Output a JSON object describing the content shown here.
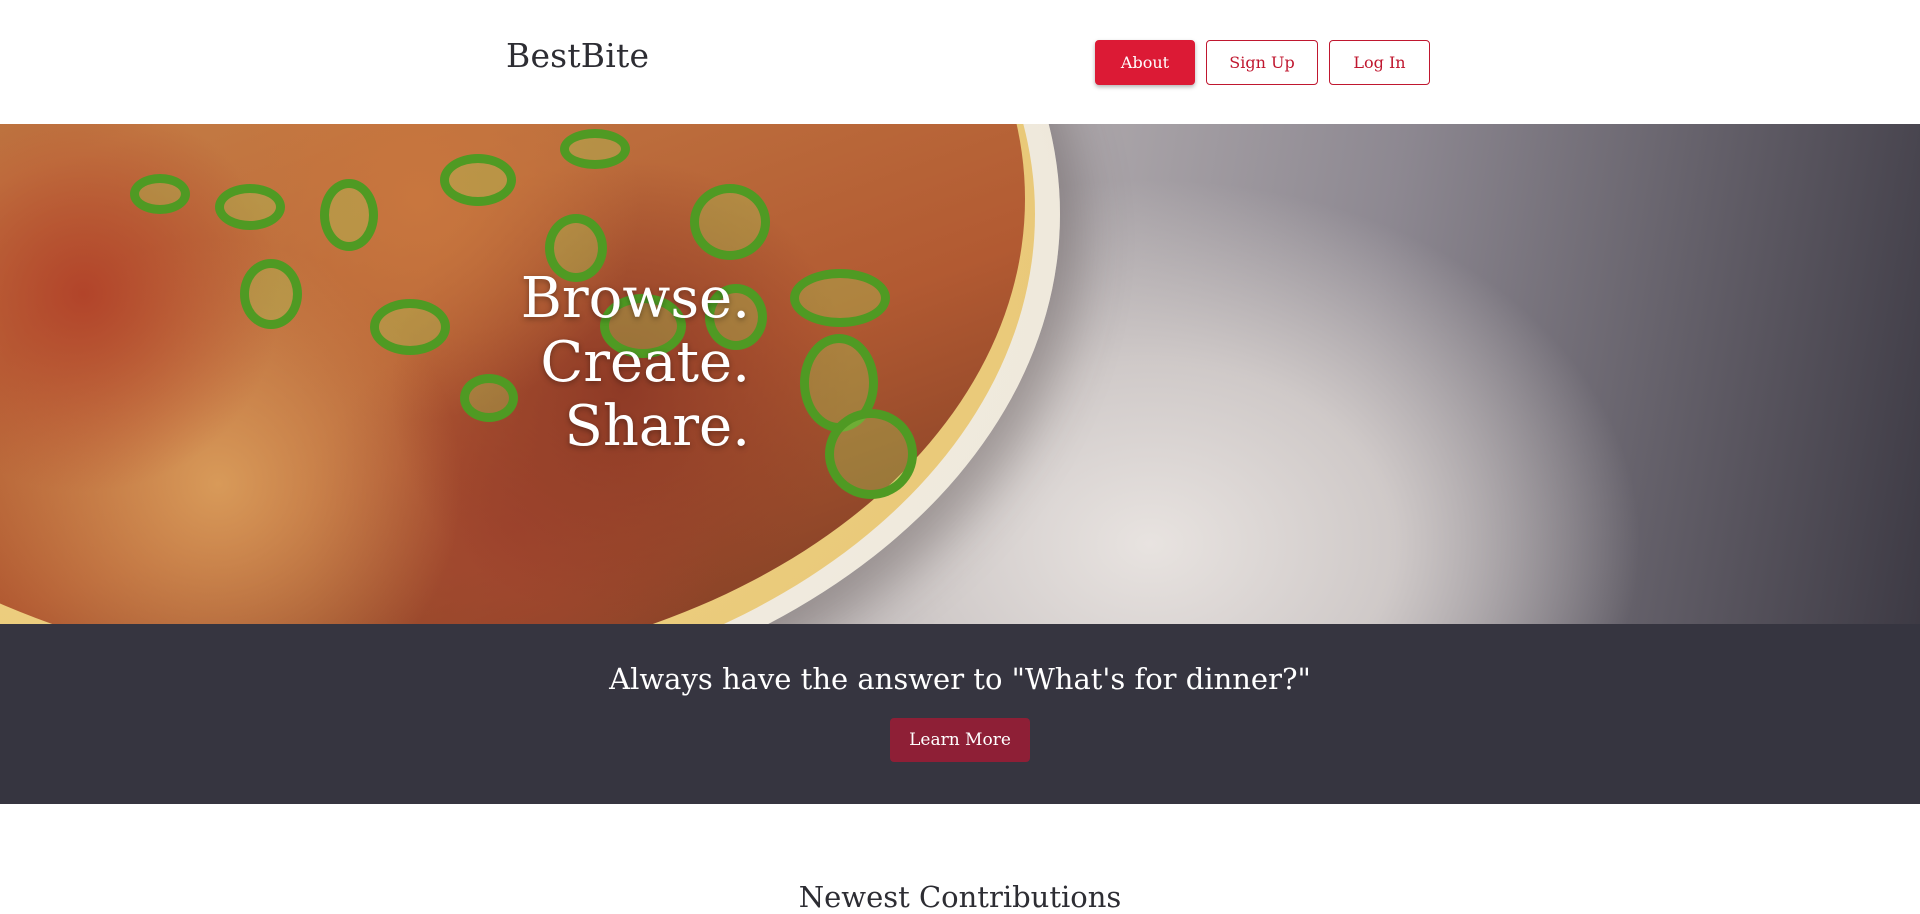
{
  "header": {
    "brand": "BestBite",
    "nav": {
      "about_label": "About",
      "signup_label": "Sign Up",
      "login_label": "Log In"
    }
  },
  "hero": {
    "lines": [
      "Browse.",
      "Create.",
      "Share."
    ]
  },
  "banner": {
    "tagline": "Always have the answer to \"What's for dinner?\"",
    "button_label": "Learn More"
  },
  "section": {
    "title": "Newest Contributions"
  },
  "colors": {
    "accent_red": "#dc1a35",
    "banner_bg": "#363540",
    "learn_more_bg": "#8e1f36"
  }
}
